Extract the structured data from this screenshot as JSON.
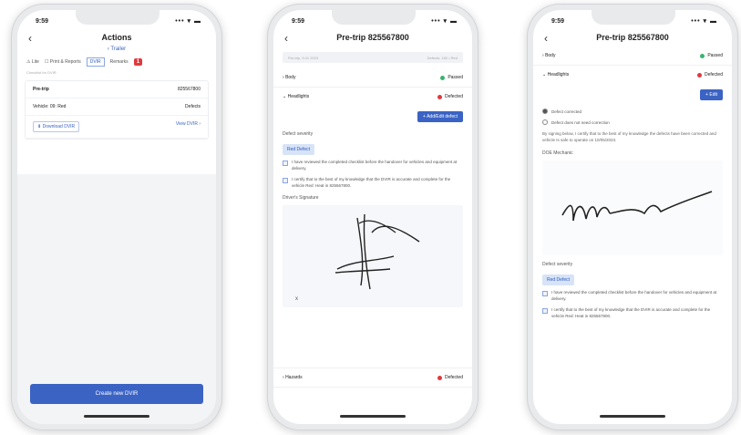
{
  "screen1": {
    "time": "9:59",
    "signal": "••• ▾ ▬",
    "title": "Actions",
    "subtitle": "‹  Trailer",
    "tabs": [
      "⚠ Lite",
      "☐ Print & Reports",
      "DVIR",
      "Remarks"
    ],
    "badge": "1",
    "caption": "Checklist for DVIR",
    "rows": [
      {
        "left": "Pre-trip",
        "right": "825567800"
      },
      {
        "left": "Vehicle: 09: Red",
        "right": "Defects"
      },
      {
        "left": "⬇ Download DVIR",
        "right": "View DVIR ›"
      }
    ],
    "bottom_button": "Create new DVIR"
  },
  "screen2": {
    "time": "9:59",
    "signal": "••• ▾ ▬",
    "title": "Pre-trip 825567800",
    "search_left": "Pre-trip, 9:41 2023",
    "search_right": "Defects: 180 • Red",
    "items": [
      {
        "label": "Body",
        "status": "Passed",
        "color": "green"
      },
      {
        "label": "Headlights",
        "status": "Defected",
        "color": "red"
      }
    ],
    "action_button": "+ Add/Edit defect",
    "defect_label": "Defect severity",
    "defect_tag": "Red Defect",
    "checks": [
      "I have reviewed the completed checklist before the handover for vehicles and equipment at delivery.",
      "I certify that to the best of my knowledge that the DVIR is accurate and complete for the vehicle Red: Heat in 825567800."
    ],
    "signature_label": "Driver's Signature",
    "sig_mark": "x",
    "bottom_item": {
      "label": "Hazards",
      "status": "Defected",
      "color": "red"
    }
  },
  "screen3": {
    "time": "9:59",
    "signal": "••• ▾ ▬",
    "title": "Pre-trip 825567800",
    "items": [
      {
        "label": "Body",
        "status": "Passed",
        "color": "green"
      },
      {
        "label": "Headlights",
        "status": "Defected",
        "color": "red"
      }
    ],
    "small_button": "+ Edit",
    "radios": [
      "Defect corrected",
      "Defect does not need correction"
    ],
    "para": "By signing below, I certify that to the best of my knowledge the defects have been corrected and vehicle Is safe to operate on 10/05/2023.",
    "signer": "DOE Mechanic",
    "defect_label": "Defect severity",
    "defect_tag": "Red Defect",
    "checks": [
      "I have reviewed the completed checklist before the handover for vehicles and equipment at delivery.",
      "I certify that to the best of my knowledge that the DVIR is accurate and complete for the vehicle Red: Heat in 825567800."
    ]
  }
}
